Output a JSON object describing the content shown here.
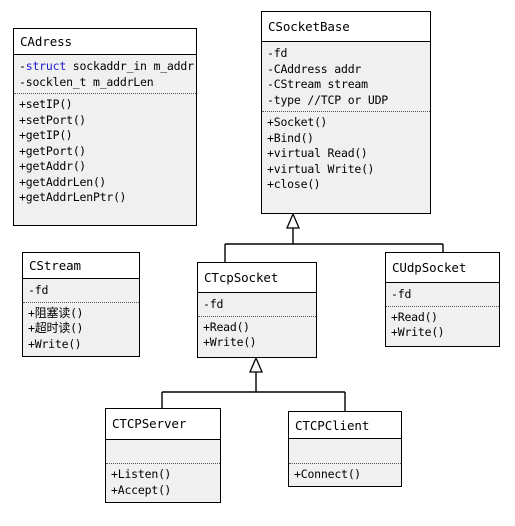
{
  "diagram": {
    "title": "Socket class hierarchy UML diagram",
    "type": "uml-class-diagram",
    "colors": {
      "box_border": "#000000",
      "header_background": "#ffffff",
      "body_background": "#f0f0f0",
      "line": "#000000",
      "keyword": "#1b1bd0",
      "separator": "#555555"
    },
    "classes": [
      {
        "id": "cadress",
        "name": "CAdress",
        "attributes": [
          {
            "visibility": "-",
            "prefix_keyword": "struct",
            "text": " sockaddr_in m_addr"
          },
          {
            "visibility": "-",
            "prefix_keyword": "",
            "text": "socklen_t m_addrLen"
          }
        ],
        "operations": [
          {
            "visibility": "+",
            "text": "setIP",
            "parens": "()"
          },
          {
            "visibility": "+",
            "text": "setPort",
            "parens": "()"
          },
          {
            "visibility": "+",
            "text": "getIP",
            "parens": "()"
          },
          {
            "visibility": "+",
            "text": "getPort",
            "parens": "()"
          },
          {
            "visibility": "+",
            "text": "getAddr",
            "parens": "()"
          },
          {
            "visibility": "+",
            "text": "getAddrLen",
            "parens": "()"
          },
          {
            "visibility": "+",
            "text": "getAddrLenPtr",
            "parens": "()"
          }
        ]
      },
      {
        "id": "csocketbase",
        "name": "CSocketBase",
        "attributes": [
          {
            "visibility": "-",
            "prefix_keyword": "",
            "text": "fd"
          },
          {
            "visibility": "-",
            "prefix_keyword": "",
            "text": "CAddress addr"
          },
          {
            "visibility": "-",
            "prefix_keyword": "",
            "text": "CStream stream"
          },
          {
            "visibility": "-",
            "prefix_keyword": "",
            "text": "type //TCP or UDP"
          }
        ],
        "operations": [
          {
            "visibility": "+",
            "text": "Socket",
            "parens": "()"
          },
          {
            "visibility": "+",
            "text": "Bind",
            "parens": "()"
          },
          {
            "visibility": "+",
            "text": "virtual Read",
            "parens": "()"
          },
          {
            "visibility": "+",
            "text": "virtual Write",
            "parens": "()"
          },
          {
            "visibility": "+",
            "text": "close",
            "parens": "()"
          }
        ]
      },
      {
        "id": "cstream",
        "name": "CStream",
        "attributes": [
          {
            "visibility": "-",
            "prefix_keyword": "",
            "text": "fd"
          }
        ],
        "operations": [
          {
            "visibility": "+",
            "text": "阻塞读",
            "parens": "()"
          },
          {
            "visibility": "+",
            "text": "超时读",
            "parens": "()"
          },
          {
            "visibility": "+",
            "text": "Write",
            "parens": "()"
          }
        ]
      },
      {
        "id": "ctcpsocket",
        "name": "CTcpSocket",
        "attributes": [
          {
            "visibility": "-",
            "prefix_keyword": "",
            "text": "fd"
          }
        ],
        "operations": [
          {
            "visibility": "+",
            "text": "Read",
            "parens": "()"
          },
          {
            "visibility": "+",
            "text": "Write",
            "parens": "()"
          }
        ]
      },
      {
        "id": "cudpsocket",
        "name": "CUdpSocket",
        "attributes": [
          {
            "visibility": "-",
            "prefix_keyword": "",
            "text": "fd"
          }
        ],
        "operations": [
          {
            "visibility": "+",
            "text": "Read",
            "parens": "()"
          },
          {
            "visibility": "+",
            "text": "Write",
            "parens": "()"
          }
        ]
      },
      {
        "id": "ctcpserver",
        "name": "CTCPServer",
        "attributes": [],
        "operations": [
          {
            "visibility": "+",
            "text": "Listen",
            "parens": "()"
          },
          {
            "visibility": "+",
            "text": "Accept",
            "parens": "()"
          }
        ]
      },
      {
        "id": "ctcpclient",
        "name": "CTCPClient",
        "attributes": [],
        "operations": [
          {
            "visibility": "+",
            "text": "Connect",
            "parens": "()"
          }
        ]
      }
    ],
    "relationships": [
      {
        "type": "generalization",
        "from": "ctcpsocket",
        "to": "csocketbase"
      },
      {
        "type": "generalization",
        "from": "cudpsocket",
        "to": "csocketbase"
      },
      {
        "type": "generalization",
        "from": "ctcpserver",
        "to": "ctcpsocket"
      },
      {
        "type": "generalization",
        "from": "ctcpclient",
        "to": "ctcpsocket"
      }
    ]
  }
}
